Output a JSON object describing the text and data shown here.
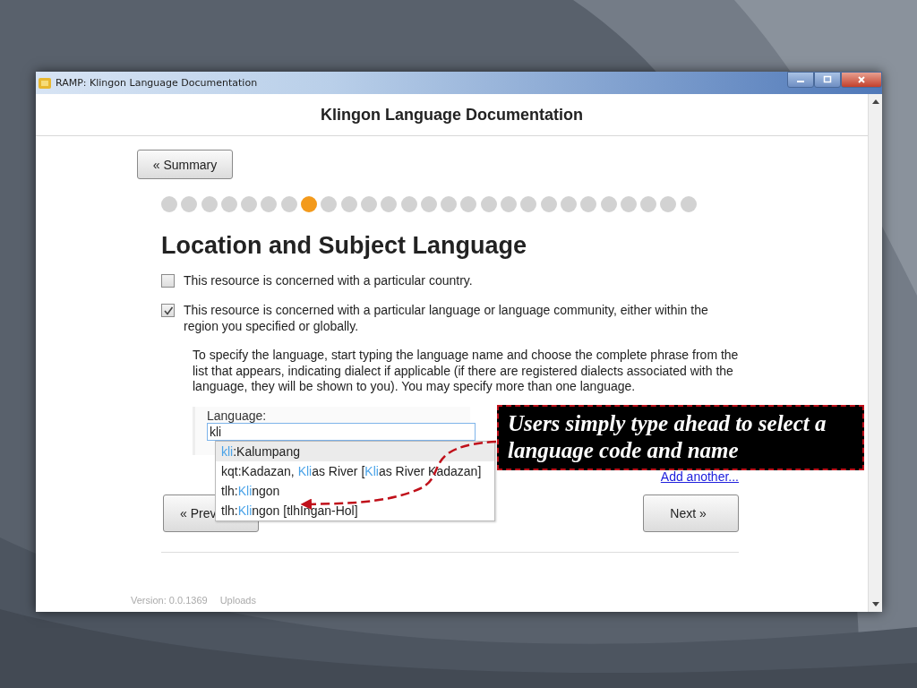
{
  "window": {
    "title": "RAMP: Klingon Language Documentation"
  },
  "page_title": "Klingon Language Documentation",
  "summary_button": "« Summary",
  "progress": {
    "steps": [
      {
        "selected": false
      },
      {
        "selected": false
      },
      {
        "selected": false
      },
      {
        "selected": false
      },
      {
        "selected": false
      },
      {
        "selected": false
      },
      {
        "selected": false
      },
      {
        "selected": true
      },
      {
        "selected": false
      },
      {
        "selected": false
      },
      {
        "selected": false
      },
      {
        "selected": false
      },
      {
        "selected": false
      },
      {
        "selected": false
      },
      {
        "selected": false
      },
      {
        "selected": false
      },
      {
        "selected": false
      },
      {
        "selected": false
      },
      {
        "selected": false
      },
      {
        "selected": false
      },
      {
        "selected": false
      },
      {
        "selected": false
      },
      {
        "selected": false
      },
      {
        "selected": false
      },
      {
        "selected": false
      },
      {
        "selected": false
      },
      {
        "selected": false
      }
    ]
  },
  "heading": "Location and Subject Language",
  "options": [
    {
      "label": "This resource is concerned with a particular country.",
      "checked": false
    },
    {
      "label": "This resource is concerned with a particular language or language community, either within the region you specified or globally.",
      "checked": true
    }
  ],
  "instructions": "To specify the language, start typing the language name and choose the complete phrase from the list that appears, indicating dialect if applicable (if there are registered dialects associated with the language, they will be shown to you). You may specify more than one language.",
  "language_field": {
    "label": "Language:",
    "value": "kli"
  },
  "suggestions": [
    {
      "selected": true,
      "segments": [
        {
          "text": "kli",
          "match": true
        },
        {
          "text": ":Kalumpang",
          "match": false
        }
      ]
    },
    {
      "selected": false,
      "segments": [
        {
          "text": "kqt:Kadazan, ",
          "match": false
        },
        {
          "text": "Kli",
          "match": true
        },
        {
          "text": "as River [",
          "match": false
        },
        {
          "text": "Kli",
          "match": true
        },
        {
          "text": "as River Kadazan]",
          "match": false
        }
      ]
    },
    {
      "selected": false,
      "segments": [
        {
          "text": "tlh:",
          "match": false
        },
        {
          "text": "Kli",
          "match": true
        },
        {
          "text": "ngon",
          "match": false
        }
      ]
    },
    {
      "selected": false,
      "segments": [
        {
          "text": "tlh:",
          "match": false
        },
        {
          "text": "Kli",
          "match": true
        },
        {
          "text": "ngon [tlhIngan-Hol]",
          "match": false
        }
      ]
    }
  ],
  "add_another": "Add another...",
  "previous_button": "« Prev",
  "next_button": "Next »",
  "footer": [
    "Version: 0.0.1369",
    "Uploads"
  ],
  "callout": "Users simply type ahead to select a language code and name"
}
